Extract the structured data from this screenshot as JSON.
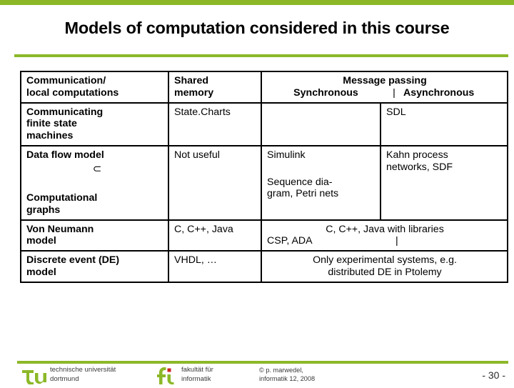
{
  "slide": {
    "title": "Models of computation considered in this course",
    "accent_color": "#8cb828",
    "rule_color": "#8cb828"
  },
  "table": {
    "header": {
      "col1": "Communication/\nlocal computations",
      "col1_line1": "Communication/",
      "col1_line2": "local computations",
      "col2_line1": "Shared",
      "col2_line2": "memory",
      "message_passing_title": "Message passing",
      "synchronous": "Synchronous",
      "separator": "|",
      "asynchronous": "Asynchronous"
    },
    "rows": [
      {
        "model_line1": "Communicating",
        "model_line2": "finite state",
        "model_line3": "machines",
        "shared_memory": "State.Charts",
        "synchronous": "",
        "asynchronous": "SDL"
      },
      {
        "model_line1": "Data flow model",
        "model_symbol": "⊂",
        "model_line2": "Computational",
        "model_line3": "graphs",
        "shared_memory": "Not useful",
        "msg_line1": "Simulink",
        "msg_line2": "Sequence dia-",
        "msg_line3": "gram, Petri nets",
        "asynchronous_line1": "Kahn process",
        "asynchronous_line2": "networks, SDF"
      },
      {
        "model_line1": "Von Neumann",
        "model_line2": "model",
        "shared_memory": "C, C++, Java",
        "msg_line1": "C, C++, Java with libraries",
        "msg_line2": "CSP, ADA",
        "msg_pipe": "|"
      },
      {
        "model_line1": "Discrete event (DE)",
        "model_line2": "model",
        "shared_memory": "VHDL, …",
        "msg_line1": "Only experimental systems, e.g.",
        "msg_line2": "distributed DE in Ptolemy"
      }
    ]
  },
  "footer": {
    "university_line1": "technische universität",
    "university_line2": "dortmund",
    "faculty_line1": "fakultät für",
    "faculty_line2": "informatik",
    "copyright_line1": "© p. marwedel,",
    "copyright_line2": "informatik 12,  2008",
    "page_number": "-  30  -",
    "logo_green": "#8cb828",
    "logo_red": "#cc2222"
  }
}
